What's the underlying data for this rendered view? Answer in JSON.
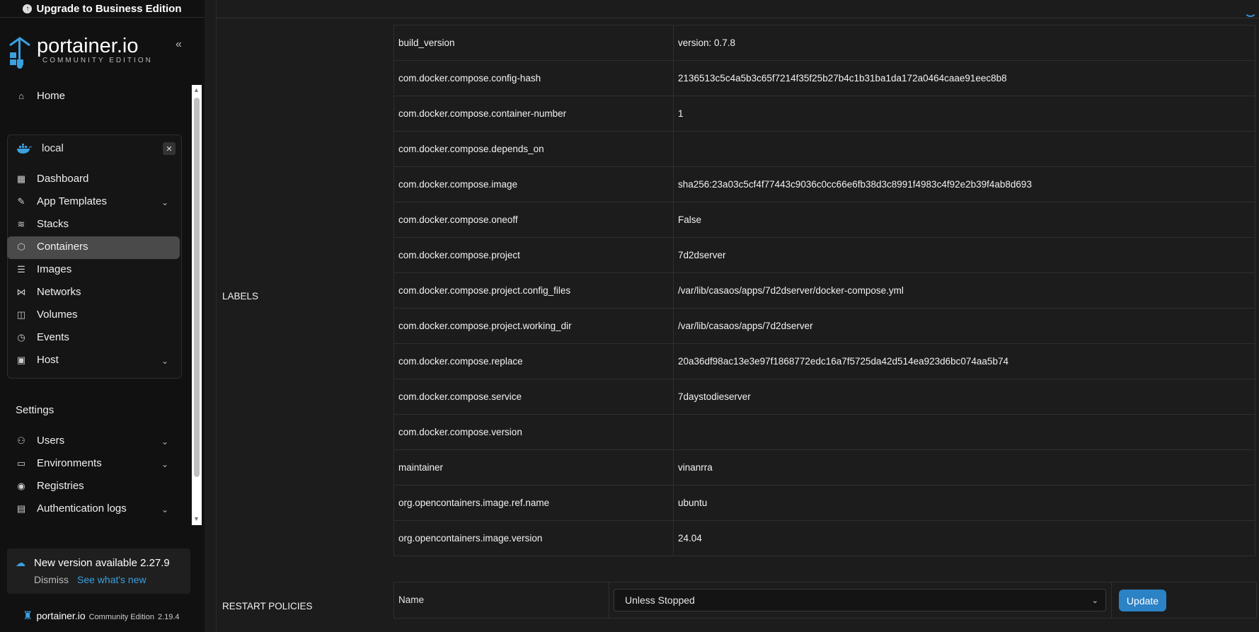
{
  "upgrade": {
    "label": "Upgrade to Business Edition"
  },
  "brand": {
    "name": "portainer.io",
    "edition": "COMMUNITY EDITION"
  },
  "sidebar": {
    "home": "Home",
    "environment": {
      "name": "local"
    },
    "env_items": [
      "Dashboard",
      "App Templates",
      "Stacks",
      "Containers",
      "Images",
      "Networks",
      "Volumes",
      "Events",
      "Host"
    ],
    "active": "Containers",
    "settings_heading": "Settings",
    "settings_items": [
      "Users",
      "Environments",
      "Registries",
      "Authentication logs"
    ]
  },
  "notice": {
    "title": "New version available 2.27.9",
    "dismiss": "Dismiss",
    "whats_new": "See what's new"
  },
  "footer": {
    "brand": "portainer.io",
    "edition": "Community Edition",
    "version": "2.19.4"
  },
  "labels_section": {
    "title": "LABELS",
    "rows": [
      {
        "key": "build_version",
        "value": "version: 0.7.8"
      },
      {
        "key": "com.docker.compose.config-hash",
        "value": "2136513c5c4a5b3c65f7214f35f25b27b4c1b31ba1da172a0464caae91eec8b8"
      },
      {
        "key": "com.docker.compose.container-number",
        "value": "1"
      },
      {
        "key": "com.docker.compose.depends_on",
        "value": ""
      },
      {
        "key": "com.docker.compose.image",
        "value": "sha256:23a03c5cf4f77443c9036c0cc66e6fb38d3c8991f4983c4f92e2b39f4ab8d693"
      },
      {
        "key": "com.docker.compose.oneoff",
        "value": "False"
      },
      {
        "key": "com.docker.compose.project",
        "value": "7d2dserver"
      },
      {
        "key": "com.docker.compose.project.config_files",
        "value": "/var/lib/casaos/apps/7d2dserver/docker-compose.yml"
      },
      {
        "key": "com.docker.compose.project.working_dir",
        "value": "/var/lib/casaos/apps/7d2dserver"
      },
      {
        "key": "com.docker.compose.replace",
        "value": "20a36df98ac13e3e97f1868772edc16a7f5725da42d514ea923d6bc074aa5b74"
      },
      {
        "key": "com.docker.compose.service",
        "value": "7daystodieserver"
      },
      {
        "key": "com.docker.compose.version",
        "value": ""
      },
      {
        "key": "maintainer",
        "value": "vinanrra"
      },
      {
        "key": "org.opencontainers.image.ref.name",
        "value": "ubuntu"
      },
      {
        "key": "org.opencontainers.image.version",
        "value": "24.04"
      }
    ]
  },
  "restart": {
    "title": "RESTART POLICIES",
    "name_label": "Name",
    "selected": "Unless Stopped",
    "update_label": "Update"
  }
}
